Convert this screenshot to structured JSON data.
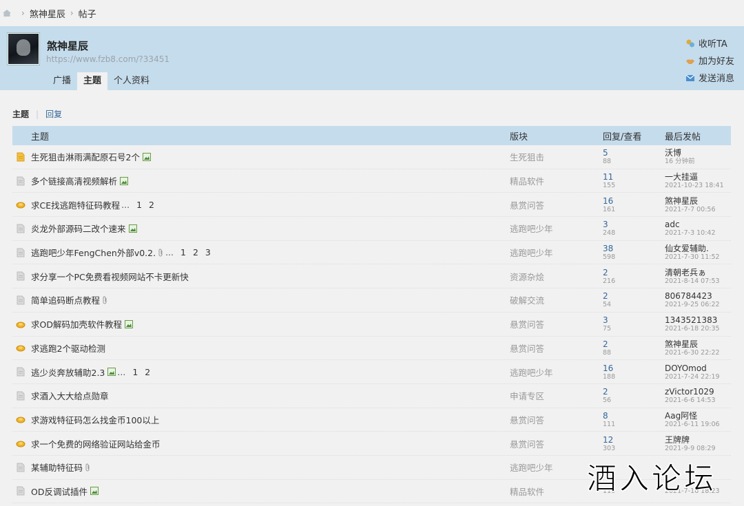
{
  "breadcrumb": {
    "items": [
      "煞神星辰",
      "帖子"
    ]
  },
  "profile": {
    "username": "煞神星辰",
    "url": "https://www.fzb8.com/?33451",
    "tabs": [
      "广播",
      "主题",
      "个人资料"
    ],
    "actions": {
      "follow": "收听TA",
      "add_friend": "加为好友",
      "message": "发送消息"
    }
  },
  "sub_tabs": {
    "topics": "主题",
    "replies": "回复"
  },
  "table": {
    "headers": {
      "title": "主题",
      "forum": "版块",
      "stats": "回复/查看",
      "last": "最后发帖"
    },
    "rows": [
      {
        "icon": "folder-hot",
        "title": "生死狙击淋雨满配原石号2个",
        "img": true,
        "clip": false,
        "pages": [],
        "forum": "生死狙击",
        "replies": "5",
        "views": "88",
        "last_author": "沃博",
        "last_time": "16 分钟前"
      },
      {
        "icon": "folder",
        "title": "多个链接高清视频解析",
        "img": true,
        "clip": false,
        "pages": [],
        "forum": "精品软件",
        "replies": "11",
        "views": "155",
        "last_author": "一大挂逼",
        "last_time": "2021-10-23 18:41"
      },
      {
        "icon": "reward",
        "title": "求CE找逃跑特征码教程",
        "img": false,
        "clip": false,
        "pages": [
          "1",
          "2"
        ],
        "forum": "悬赏问答",
        "replies": "16",
        "views": "161",
        "last_author": "煞神星辰",
        "last_time": "2021-7-7 00:56"
      },
      {
        "icon": "folder",
        "title": "炎龙外部源码二改个速来",
        "img": true,
        "clip": false,
        "pages": [],
        "forum": "逃跑吧少年",
        "replies": "3",
        "views": "248",
        "last_author": "adc",
        "last_time": "2021-7-3 10:42"
      },
      {
        "icon": "folder",
        "title": "逃跑吧少年FengChen外部v0.2.",
        "img": false,
        "clip": true,
        "pages": [
          "1",
          "2",
          "3"
        ],
        "forum": "逃跑吧少年",
        "replies": "38",
        "views": "598",
        "last_author": "仙女爱辅助.",
        "last_time": "2021-7-30 11:52"
      },
      {
        "icon": "folder",
        "title": "求分享一个PC免费看视频网站不卡更新快",
        "img": false,
        "clip": false,
        "pages": [],
        "forum": "资源杂烩",
        "replies": "2",
        "views": "216",
        "last_author": "清朝老兵ぁ",
        "last_time": "2021-8-14 07:53"
      },
      {
        "icon": "folder",
        "title": "简单追码断点教程",
        "img": false,
        "clip": true,
        "pages": [],
        "forum": "破解交流",
        "replies": "2",
        "views": "54",
        "last_author": "806784423",
        "last_time": "2021-9-25 06:22"
      },
      {
        "icon": "reward",
        "title": "求OD解码加壳软件教程",
        "img": true,
        "clip": false,
        "pages": [],
        "forum": "悬赏问答",
        "replies": "3",
        "views": "75",
        "last_author": "1343521383",
        "last_time": "2021-6-18 20:35"
      },
      {
        "icon": "reward",
        "title": "求逃跑2个驱动检测",
        "img": false,
        "clip": false,
        "pages": [],
        "forum": "悬赏问答",
        "replies": "2",
        "views": "88",
        "last_author": "煞神星辰",
        "last_time": "2021-6-30 22:22"
      },
      {
        "icon": "folder",
        "title": "逃少炎奔放辅助2.3",
        "img": true,
        "clip": false,
        "pages": [
          "1",
          "2"
        ],
        "forum": "逃跑吧少年",
        "replies": "16",
        "views": "188",
        "last_author": "DOYOmod",
        "last_time": "2021-7-24 22:19"
      },
      {
        "icon": "folder",
        "title": "求酒入大大给点勋章",
        "img": false,
        "clip": false,
        "pages": [],
        "forum": "申请专区",
        "replies": "2",
        "views": "56",
        "last_author": "zVictor1029",
        "last_time": "2021-6-6 14:53"
      },
      {
        "icon": "reward",
        "title": "求游戏特征码怎么找金币100以上",
        "img": false,
        "clip": false,
        "pages": [],
        "forum": "悬赏问答",
        "replies": "8",
        "views": "111",
        "last_author": "Aag阿怪",
        "last_time": "2021-6-11 19:06"
      },
      {
        "icon": "reward",
        "title": "求一个免费的网络验证网站给金币",
        "img": false,
        "clip": false,
        "pages": [],
        "forum": "悬赏问答",
        "replies": "12",
        "views": "303",
        "last_author": "王牌牌",
        "last_time": "2021-9-9 08:29"
      },
      {
        "icon": "folder",
        "title": "某辅助特征码",
        "img": false,
        "clip": true,
        "pages": [],
        "forum": "逃跑吧少年",
        "replies": "",
        "views": "",
        "last_author": "",
        "last_time": ""
      },
      {
        "icon": "folder",
        "title": "OD反调试插件",
        "img": true,
        "clip": false,
        "pages": [],
        "forum": "精品软件",
        "replies": "",
        "views": "110",
        "last_author": "",
        "last_time": "2021-7-16 18:23"
      }
    ]
  },
  "watermark": "酒入论坛",
  "colors": {
    "header_bg": "#c5dcec",
    "page_bg": "#f1f1f1",
    "link": "#336699",
    "muted": "#999999"
  }
}
